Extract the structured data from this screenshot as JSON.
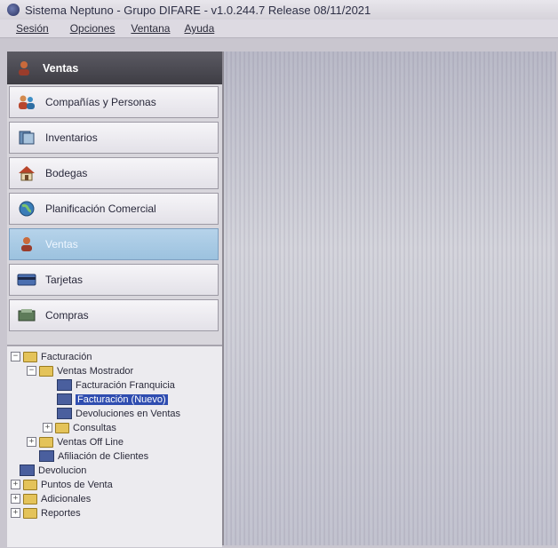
{
  "window": {
    "title": "Sistema Neptuno - Grupo DIFARE - v1.0.244.7 Release 08/11/2021",
    "icon": "app-logo-icon"
  },
  "menu": {
    "items": [
      "Sesión",
      "Opciones",
      "Ventana",
      "Ayuda"
    ]
  },
  "sidebar": {
    "header": {
      "label": "Ventas",
      "icon": "sales-person-icon"
    },
    "items": [
      {
        "label": "Compañías y Personas",
        "icon": "people-icon"
      },
      {
        "label": "Inventarios",
        "icon": "inventory-icon"
      },
      {
        "label": "Bodegas",
        "icon": "warehouse-icon"
      },
      {
        "label": "Planificación Comercial",
        "icon": "globe-icon"
      },
      {
        "label": "Ventas",
        "icon": "sales-person-icon",
        "active": true
      },
      {
        "label": "Tarjetas",
        "icon": "card-icon"
      },
      {
        "label": "Compras",
        "icon": "purchases-icon"
      }
    ]
  },
  "tree": {
    "nodes": [
      {
        "label": "Facturación",
        "type": "folder",
        "expander": "−"
      },
      {
        "label": "Ventas Mostrador",
        "type": "folder",
        "expander": "−"
      },
      {
        "label": "Facturación Franquicia",
        "type": "doc"
      },
      {
        "label": "Facturación (Nuevo)",
        "type": "doc",
        "selected": true
      },
      {
        "label": "Devoluciones en Ventas",
        "type": "doc"
      },
      {
        "label": "Consultas",
        "type": "folder",
        "expander": "+"
      },
      {
        "label": "Ventas Off Line",
        "type": "folder",
        "expander": "+"
      },
      {
        "label": "Afiliación de Clientes",
        "type": "doc"
      },
      {
        "label": "Devolucion",
        "type": "doc"
      },
      {
        "label": "Puntos de Venta",
        "type": "folder",
        "expander": "+"
      },
      {
        "label": "Adicionales",
        "type": "folder",
        "expander": "+"
      },
      {
        "label": "Reportes",
        "type": "folder",
        "expander": "+"
      }
    ]
  },
  "colors": {
    "nav_header": "#4a4950",
    "nav_active": "#a8c8e3",
    "tree_selected": "#2f4db0"
  }
}
